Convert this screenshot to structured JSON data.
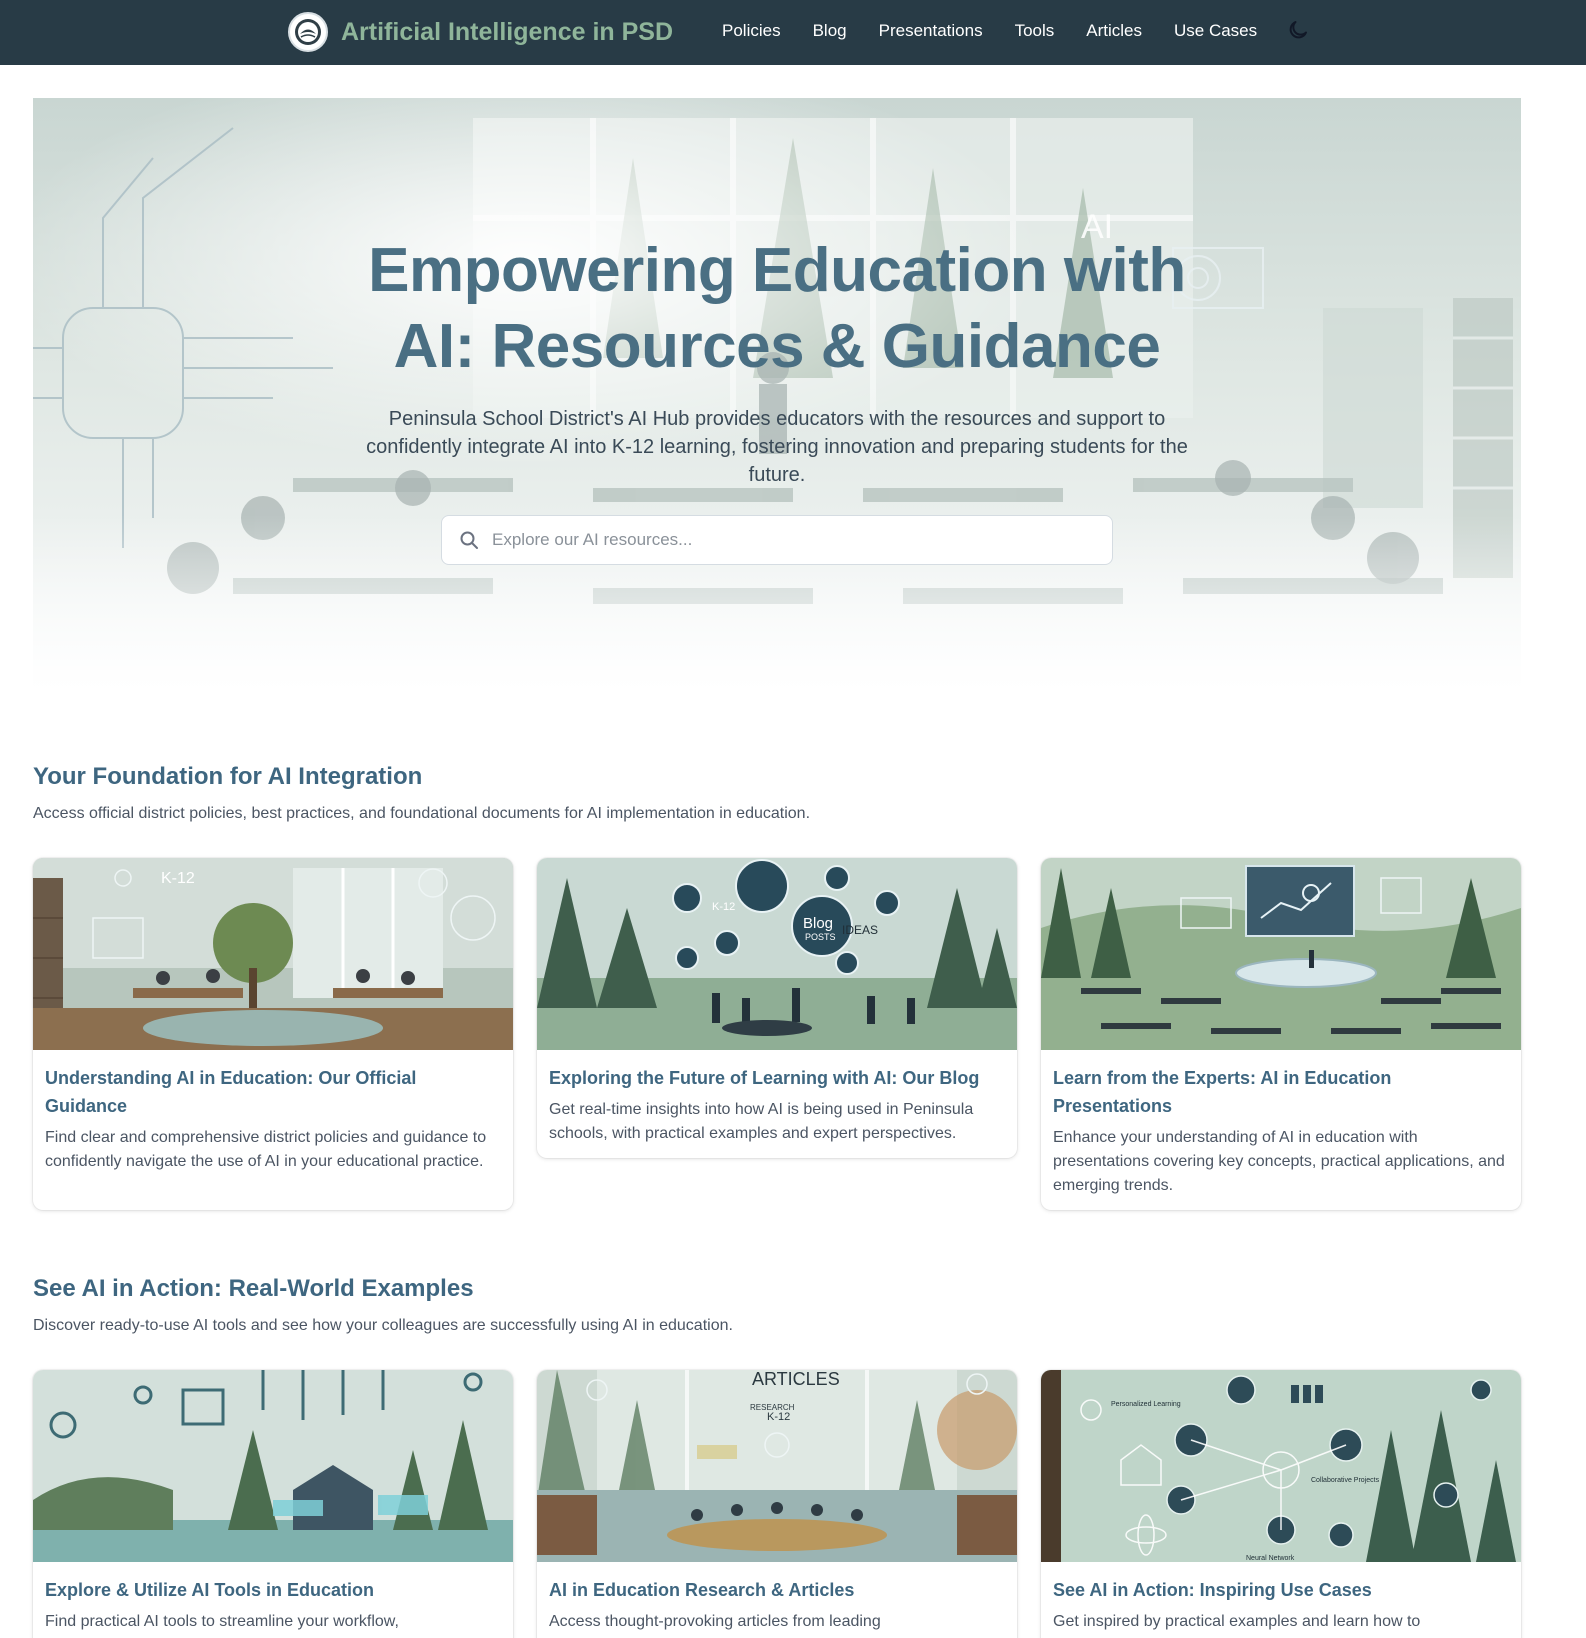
{
  "nav": {
    "brand_title": "Artificial Intelligence in PSD",
    "links": [
      "Policies",
      "Blog",
      "Presentations",
      "Tools",
      "Articles",
      "Use Cases"
    ],
    "theme_icon": "moon-icon"
  },
  "hero": {
    "title_line1": "Empowering Education with",
    "title_line2": "AI: Resources & Guidance",
    "subtitle": "Peninsula School District's AI Hub provides educators with the resources and support to confidently integrate AI into K-12 learning, fostering innovation and preparing students for the future.",
    "search_placeholder": "Explore our AI resources...",
    "image_text": "AI"
  },
  "foundation": {
    "title": "Your Foundation for AI Integration",
    "description": "Access official district policies, best practices, and foundational documents for AI implementation in education.",
    "cards": [
      {
        "title": "Understanding AI in Education: Our Official Guidance",
        "text": "Find clear and comprehensive district policies and guidance to confidently navigate the use of AI in your educational practice.",
        "image_text": "K-12"
      },
      {
        "title": "Exploring the Future of Learning with AI: Our Blog",
        "text": "Get real-time insights into how AI is being used in Peninsula schools, with practical examples and expert perspectives.",
        "image_text": [
          "K-12",
          "Blog",
          "POSTS",
          "IDEAS"
        ]
      },
      {
        "title": "Learn from the Experts: AI in Education Presentations",
        "text": "Enhance your understanding of AI in education with presentations covering key concepts, practical applications, and emerging trends.",
        "image_text": ""
      }
    ]
  },
  "action": {
    "title": "See AI in Action: Real-World Examples",
    "description": "Discover ready-to-use AI tools and see how your colleagues are successfully using AI in education.",
    "cards": [
      {
        "title": "Explore & Utilize AI Tools in Education",
        "text": "Find practical AI tools to streamline your workflow,",
        "image_text": ""
      },
      {
        "title": "AI in Education Research & Articles",
        "text": "Access thought-provoking articles from leading",
        "image_text": [
          "ARTICLES",
          "RESEARCH",
          "K-12"
        ]
      },
      {
        "title": "See AI in Action: Inspiring Use Cases",
        "text": "Get inspired by practical examples and learn how to",
        "image_text": [
          "Personalized Learning",
          "Collaborative Projects",
          "Neural Network"
        ]
      }
    ]
  }
}
